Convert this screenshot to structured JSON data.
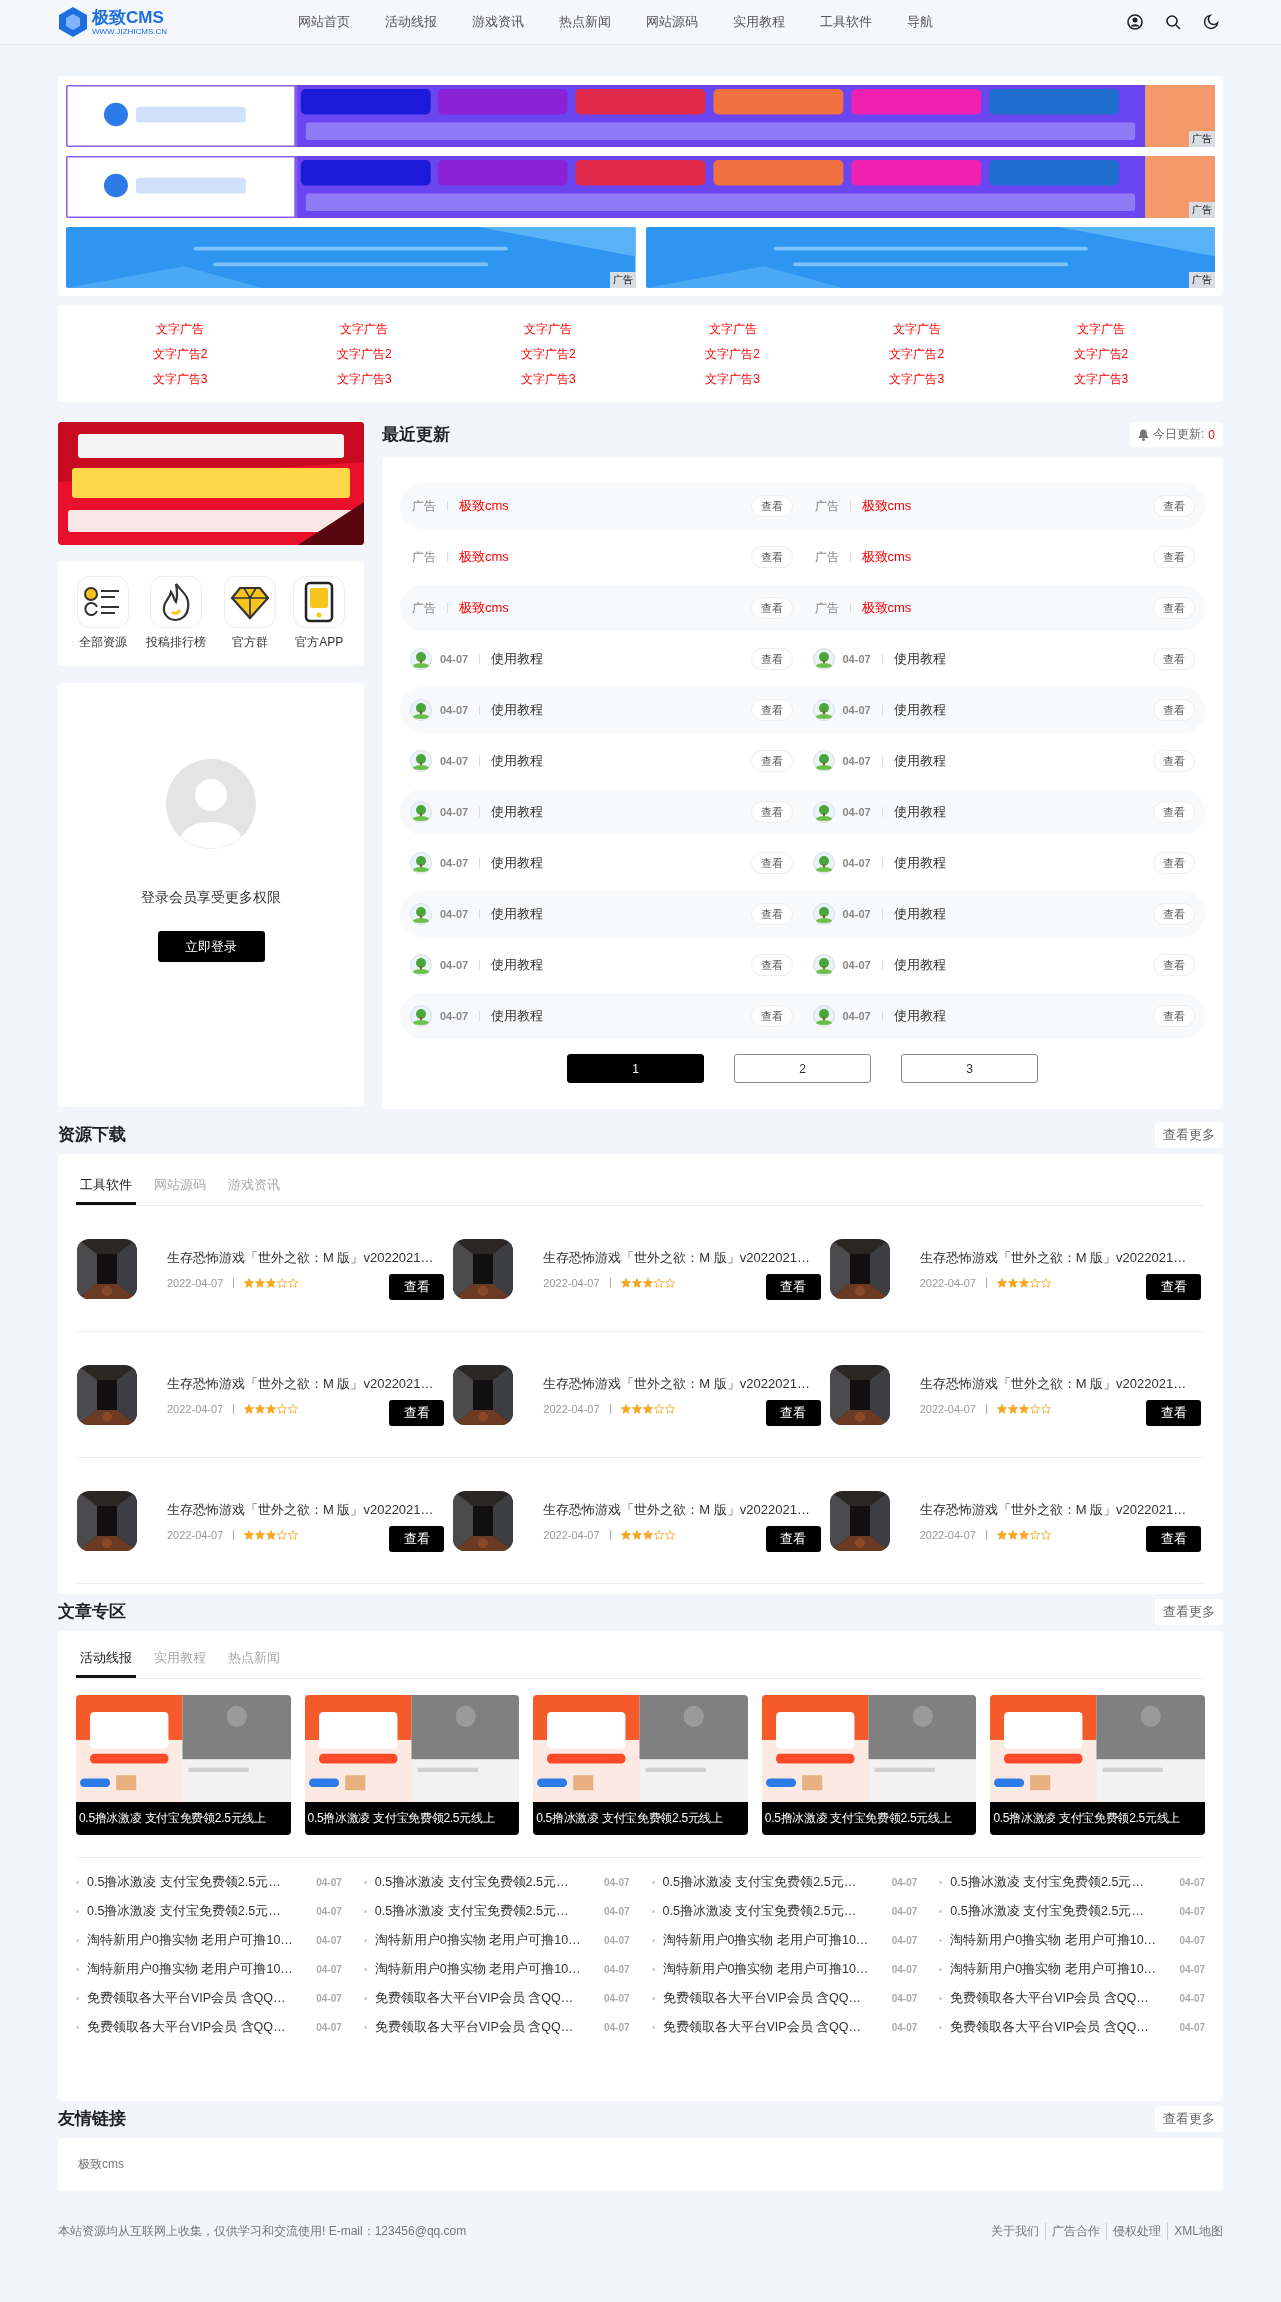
{
  "header": {
    "logo": {
      "name": "极致CMS",
      "tagline": "WWW.JIZHICMS.CN"
    },
    "nav": [
      "网站首页",
      "活动线报",
      "游戏资讯",
      "热点新闻",
      "网站源码",
      "实用教程",
      "工具软件",
      "导航"
    ]
  },
  "banners": {
    "wide": [
      {
        "tag": "广告"
      },
      {
        "tag": "广告"
      }
    ],
    "small": [
      {
        "tag": "广告"
      },
      {
        "tag": "广告"
      }
    ]
  },
  "text_ads": [
    "文字广告",
    "文字广告",
    "文字广告",
    "文字广告",
    "文字广告",
    "文字广告",
    "文字广告2",
    "文字广告2",
    "文字广告2",
    "文字广告2",
    "文字广告2",
    "文字广告2",
    "文字广告3",
    "文字广告3",
    "文字广告3",
    "文字广告3",
    "文字广告3",
    "文字广告3"
  ],
  "sidebar": {
    "shortcuts": [
      {
        "label": "全部资源",
        "kind": "list"
      },
      {
        "label": "投稿排行榜",
        "kind": "flame"
      },
      {
        "label": "官方群",
        "kind": "diamond"
      },
      {
        "label": "官方APP",
        "kind": "app"
      }
    ],
    "login": {
      "message": "登录会员享受更多权限",
      "button": "立即登录"
    }
  },
  "recent": {
    "title": "最近更新",
    "today_label": "今日更新:",
    "today_count": "0",
    "rows": [
      {
        "items": [
          {
            "kind": "ad",
            "tag": "广告",
            "title": "极致cms",
            "action": "查看"
          },
          {
            "kind": "ad",
            "tag": "广告",
            "title": "极致cms",
            "action": "查看"
          }
        ]
      },
      {
        "items": [
          {
            "kind": "ad",
            "tag": "广告",
            "title": "极致cms",
            "action": "查看"
          },
          {
            "kind": "ad",
            "tag": "广告",
            "title": "极致cms",
            "action": "查看"
          }
        ]
      },
      {
        "items": [
          {
            "kind": "ad",
            "tag": "广告",
            "title": "极致cms",
            "action": "查看"
          },
          {
            "kind": "ad",
            "tag": "广告",
            "title": "极致cms",
            "action": "查看"
          }
        ]
      },
      {
        "items": [
          {
            "kind": "post",
            "date": "04-07",
            "title": "使用教程",
            "action": "查看"
          },
          {
            "kind": "post",
            "date": "04-07",
            "title": "使用教程",
            "action": "查看"
          }
        ]
      },
      {
        "items": [
          {
            "kind": "post",
            "date": "04-07",
            "title": "使用教程",
            "action": "查看"
          },
          {
            "kind": "post",
            "date": "04-07",
            "title": "使用教程",
            "action": "查看"
          }
        ]
      },
      {
        "items": [
          {
            "kind": "post",
            "date": "04-07",
            "title": "使用教程",
            "action": "查看"
          },
          {
            "kind": "post",
            "date": "04-07",
            "title": "使用教程",
            "action": "查看"
          }
        ]
      },
      {
        "items": [
          {
            "kind": "post",
            "date": "04-07",
            "title": "使用教程",
            "action": "查看"
          },
          {
            "kind": "post",
            "date": "04-07",
            "title": "使用教程",
            "action": "查看"
          }
        ]
      },
      {
        "items": [
          {
            "kind": "post",
            "date": "04-07",
            "title": "使用教程",
            "action": "查看"
          },
          {
            "kind": "post",
            "date": "04-07",
            "title": "使用教程",
            "action": "查看"
          }
        ]
      },
      {
        "items": [
          {
            "kind": "post",
            "date": "04-07",
            "title": "使用教程",
            "action": "查看"
          },
          {
            "kind": "post",
            "date": "04-07",
            "title": "使用教程",
            "action": "查看"
          }
        ]
      },
      {
        "items": [
          {
            "kind": "post",
            "date": "04-07",
            "title": "使用教程",
            "action": "查看"
          },
          {
            "kind": "post",
            "date": "04-07",
            "title": "使用教程",
            "action": "查看"
          }
        ]
      },
      {
        "items": [
          {
            "kind": "post",
            "date": "04-07",
            "title": "使用教程",
            "action": "查看"
          },
          {
            "kind": "post",
            "date": "04-07",
            "title": "使用教程",
            "action": "查看"
          }
        ]
      }
    ],
    "pages": [
      {
        "label": "1",
        "selected": true
      },
      {
        "label": "2",
        "selected": false
      },
      {
        "label": "3",
        "selected": false
      }
    ]
  },
  "downloads": {
    "title": "资源下载",
    "more": "查看更多",
    "tabs": [
      {
        "label": "工具软件",
        "selected": true
      },
      {
        "label": "网站源码",
        "selected": false
      },
      {
        "label": "游戏资讯",
        "selected": false
      }
    ],
    "items": [
      {
        "title": "生存恐怖游戏「世外之欲：M 版」v2022021…",
        "date": "2022-04-07",
        "stars": 3,
        "action": "查看"
      },
      {
        "title": "生存恐怖游戏「世外之欲：M 版」v2022021…",
        "date": "2022-04-07",
        "stars": 3,
        "action": "查看"
      },
      {
        "title": "生存恐怖游戏「世外之欲：M 版」v2022021…",
        "date": "2022-04-07",
        "stars": 3,
        "action": "查看"
      },
      {
        "title": "生存恐怖游戏「世外之欲：M 版」v2022021…",
        "date": "2022-04-07",
        "stars": 3,
        "action": "查看"
      },
      {
        "title": "生存恐怖游戏「世外之欲：M 版」v2022021…",
        "date": "2022-04-07",
        "stars": 3,
        "action": "查看"
      },
      {
        "title": "生存恐怖游戏「世外之欲：M 版」v2022021…",
        "date": "2022-04-07",
        "stars": 3,
        "action": "查看"
      },
      {
        "title": "生存恐怖游戏「世外之欲：M 版」v2022021…",
        "date": "2022-04-07",
        "stars": 3,
        "action": "查看"
      },
      {
        "title": "生存恐怖游戏「世外之欲：M 版」v2022021…",
        "date": "2022-04-07",
        "stars": 3,
        "action": "查看"
      },
      {
        "title": "生存恐怖游戏「世外之欲：M 版」v2022021…",
        "date": "2022-04-07",
        "stars": 3,
        "action": "查看"
      }
    ]
  },
  "articles": {
    "title": "文章专区",
    "more": "查看更多",
    "tabs": [
      {
        "label": "活动线报",
        "selected": true
      },
      {
        "label": "实用教程",
        "selected": false
      },
      {
        "label": "热点新闻",
        "selected": false
      }
    ],
    "featured": [
      {
        "caption": "0.5撸冰激凌 支付宝免费领2.5元线上"
      },
      {
        "caption": "0.5撸冰激凌 支付宝免费领2.5元线上"
      },
      {
        "caption": "0.5撸冰激凌 支付宝免费领2.5元线上"
      },
      {
        "caption": "0.5撸冰激凌 支付宝免费领2.5元线上"
      },
      {
        "caption": "0.5撸冰激凌 支付宝免费领2.5元线上"
      }
    ],
    "list": [
      {
        "title": "0.5撸冰激凌 支付宝免费领2.5元…",
        "date": "04-07"
      },
      {
        "title": "0.5撸冰激凌 支付宝免费领2.5元…",
        "date": "04-07"
      },
      {
        "title": "0.5撸冰激凌 支付宝免费领2.5元…",
        "date": "04-07"
      },
      {
        "title": "0.5撸冰激凌 支付宝免费领2.5元…",
        "date": "04-07"
      },
      {
        "title": "0.5撸冰激凌 支付宝免费领2.5元…",
        "date": "04-07"
      },
      {
        "title": "0.5撸冰激凌 支付宝免费领2.5元…",
        "date": "04-07"
      },
      {
        "title": "0.5撸冰激凌 支付宝免费领2.5元…",
        "date": "04-07"
      },
      {
        "title": "0.5撸冰激凌 支付宝免费领2.5元…",
        "date": "04-07"
      },
      {
        "title": "淘特新用户0撸实物 老用户可撸10…",
        "date": "04-07"
      },
      {
        "title": "淘特新用户0撸实物 老用户可撸10…",
        "date": "04-07"
      },
      {
        "title": "淘特新用户0撸实物 老用户可撸10…",
        "date": "04-07"
      },
      {
        "title": "淘特新用户0撸实物 老用户可撸10…",
        "date": "04-07"
      },
      {
        "title": "淘特新用户0撸实物 老用户可撸10…",
        "date": "04-07"
      },
      {
        "title": "淘特新用户0撸实物 老用户可撸10…",
        "date": "04-07"
      },
      {
        "title": "淘特新用户0撸实物 老用户可撸10…",
        "date": "04-07"
      },
      {
        "title": "淘特新用户0撸实物 老用户可撸10…",
        "date": "04-07"
      },
      {
        "title": "免费领取各大平台VIP会员 含QQ…",
        "date": "04-07"
      },
      {
        "title": "免费领取各大平台VIP会员 含QQ…",
        "date": "04-07"
      },
      {
        "title": "免费领取各大平台VIP会员 含QQ…",
        "date": "04-07"
      },
      {
        "title": "免费领取各大平台VIP会员 含QQ…",
        "date": "04-07"
      },
      {
        "title": "免费领取各大平台VIP会员 含QQ…",
        "date": "04-07"
      },
      {
        "title": "免费领取各大平台VIP会员 含QQ…",
        "date": "04-07"
      },
      {
        "title": "免费领取各大平台VIP会员 含QQ…",
        "date": "04-07"
      },
      {
        "title": "免费领取各大平台VIP会员 含QQ…",
        "date": "04-07"
      }
    ]
  },
  "friend_links": {
    "title": "友情链接",
    "more": "查看更多",
    "links": [
      "极致cms"
    ]
  },
  "footer": {
    "notice": "本站资源均从互联网上收集，仅供学习和交流使用! E-mail：123456@qq.com",
    "links": [
      "关于我们",
      "广告合作",
      "侵权处理",
      "XML地图"
    ]
  }
}
